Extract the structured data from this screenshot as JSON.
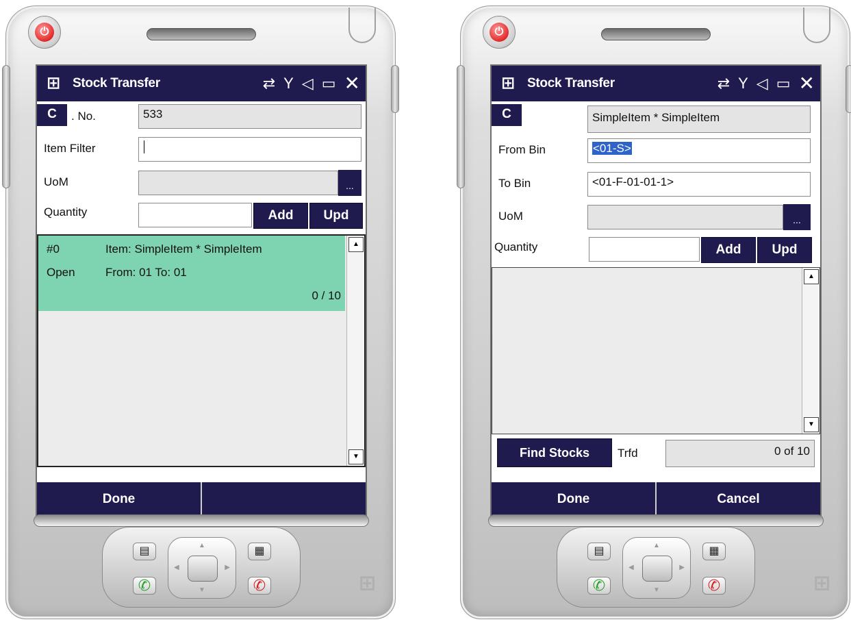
{
  "icons": {
    "windows_logo": "⊞",
    "sync": "⇄",
    "signal": "Y",
    "volume": "◁",
    "battery": "▭",
    "close": "✕",
    "scroll_up": "▲",
    "scroll_down": "▼",
    "dpad_up": "▲",
    "dpad_down": "▼",
    "dpad_left": "◀",
    "dpad_right": "▶",
    "contacts": "▤",
    "calendar": "▦",
    "call": "✆",
    "end_call": "✆"
  },
  "left_screen": {
    "title": "Stock Transfer",
    "c_button": "C",
    "doc_no_label": ". No.",
    "doc_no_value": "533",
    "item_filter_label": "Item Filter",
    "item_filter_value": "",
    "uom_label": "UoM",
    "uom_value": "",
    "uom_button": "...",
    "quantity_label": "Quantity",
    "quantity_value": "",
    "add_button": "Add",
    "upd_button": "Upd",
    "list_item": {
      "index": "#0",
      "item": "Item: SimpleItem * SimpleItem",
      "status": "Open",
      "from_to": "From: 01 To: 01",
      "qty": "0 / 10"
    },
    "softkey_left": "Done",
    "softkey_right": ""
  },
  "right_screen": {
    "title": "Stock Transfer",
    "c_button": "C",
    "item_value": "SimpleItem * SimpleItem",
    "from_bin_label": "From Bin",
    "from_bin_value": "<01-S>",
    "to_bin_label": "To Bin",
    "to_bin_value": "<01-F-01-01-1>",
    "uom_label": "UoM",
    "uom_value": "",
    "uom_button": "...",
    "quantity_label": "Quantity",
    "quantity_value": "",
    "add_button": "Add",
    "upd_button": "Upd",
    "find_stocks_button": "Find Stocks",
    "trfd_label": "Trfd",
    "trfd_value": "0 of 10",
    "softkey_left": "Done",
    "softkey_right": "Cancel"
  }
}
